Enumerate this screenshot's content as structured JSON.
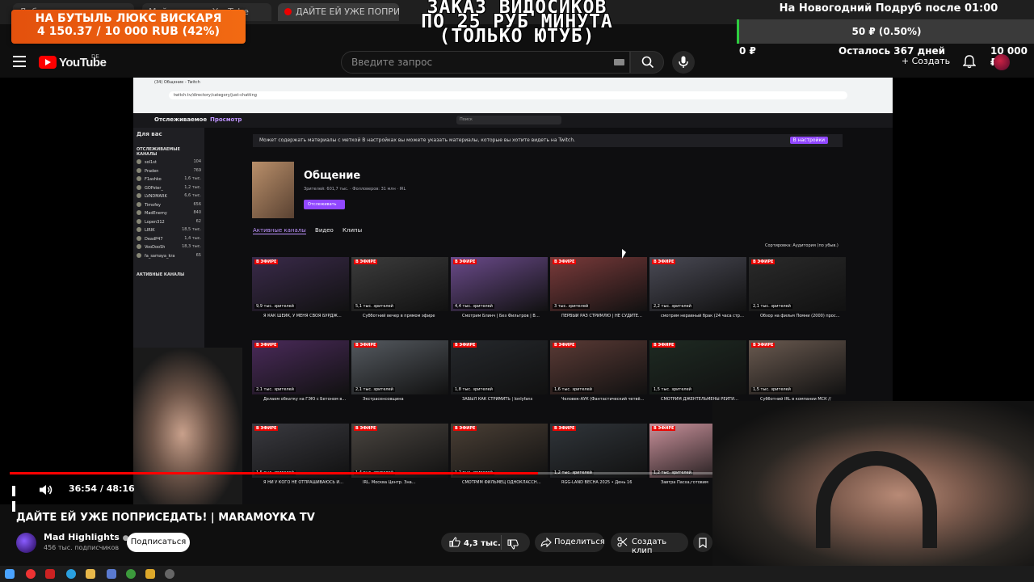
{
  "browser_tabs": [
    {
      "label": "Добро пожаловать в"
    },
    {
      "label": "Мой канал — YouTube"
    },
    {
      "label": "ДАЙТЕ ЕЙ УЖЕ ПОПРИСЕДАТЬ!"
    }
  ],
  "overlay": {
    "donation_title": "НА БУТЫЛЬ ЛЮКС ВИСКАРЯ",
    "donation_progress": "4 150.37 / 10 000 RUB (42%)",
    "donation_percent": 42,
    "promo_line1": "ЗАКАЗ ВИДОСИКОВ",
    "promo_line2": "ПО 25 РУБ МИНУТА",
    "promo_line3": "(ТОЛЬКО ЮТУБ)",
    "goal_title": "На Новогодний Подруб после 01:00",
    "goal_progress": "50 ₽ (0.50%)",
    "goal_min": "0 ₽",
    "goal_remaining": "Осталось 367 дней",
    "goal_max": "10 000 ₽"
  },
  "youtube": {
    "logo_text": "YouTube",
    "region": "DE",
    "search_placeholder": "Введите запрос",
    "create_label": "+ Создать"
  },
  "twitch": {
    "tab_title": "(34) Общение - Twitch",
    "url": "twitch.tv/directory/category/just-chatting",
    "nav_following": "Отслеживаемое",
    "nav_browse": "Просмотр",
    "search_placeholder": "Поиск",
    "banner_text": "Может содержать материалы с меткой В настройках вы можете указать материалы, которые вы хотите видеть на Twitch.",
    "banner_button": "В настройки",
    "category_title": "Общение",
    "category_stats": "Зрителей: 601,7 тыс. · Фолловеров: 31 млн · IRL",
    "follow_button": "Отслеживать",
    "tabs": [
      "Активные каналы",
      "Видео",
      "Клипы"
    ],
    "sort_label": "Сортировка: Аудитория (по убыв.)",
    "sidebar_header": "Для вас",
    "sidebar_followed": "ОТСЛЕЖИВАЕМЫЕ КАНАЛЫ",
    "sidebar_channels": [
      {
        "name": "sol1st",
        "viewers": "104"
      },
      {
        "name": "Praden",
        "viewers": "769"
      },
      {
        "name": "F1ashko",
        "viewers": "1,6 тыс."
      },
      {
        "name": "GOPster_",
        "viewers": "1,2 тыс."
      },
      {
        "name": "LVNDMARK",
        "viewers": "6,6 тыс."
      },
      {
        "name": "Timofey",
        "viewers": "656"
      },
      {
        "name": "MadEnemy",
        "viewers": "840"
      },
      {
        "name": "Lopen312",
        "viewers": "62"
      },
      {
        "name": "LIRIK",
        "viewers": "18,5 тыс."
      },
      {
        "name": "DeadP47",
        "viewers": "1,4 тыс."
      },
      {
        "name": "VooDooSh",
        "viewers": "18,3 тыс."
      },
      {
        "name": "fa_samaya_kra",
        "viewers": "65"
      }
    ],
    "sidebar_active": "АКТИВНЫЕ КАНАЛЫ",
    "streams": [
      {
        "title": "Я КАК ШЕЙК, У МЕНЯ СВОЯ БУРДЖ…",
        "viewers": "9,9 тыс. зрителей",
        "color": "#3a2a4a"
      },
      {
        "title": "Субботний вечер в прямом эфире",
        "viewers": "5,1 тыс. зрителей",
        "color": "#3c3c3c"
      },
      {
        "title": "Смотрим Блинч | Без Фильтров | В…",
        "viewers": "4,4 тыс. зрителей",
        "color": "#6a4a8a"
      },
      {
        "title": "ПЕРВЫЙ РАЗ СТРИМЛЮ | НЕ СУДИТЕ…",
        "viewers": "3 тыс. зрителей",
        "color": "#7a3a3a"
      },
      {
        "title": "смотрим неравный брак (24 часа стр…",
        "viewers": "2,2 тыс. зрителей",
        "color": "#4a4a55"
      },
      {
        "title": "Обзор на фильм Помни (2000) прос…",
        "viewers": "2,1 тыс. зрителей",
        "color": "#2a2a2a"
      },
      {
        "title": "Делаем обкатку на ГЭЮ с Бетоном в…",
        "viewers": "2,1 тыс. зрителей",
        "color": "#4a2a5a"
      },
      {
        "title": "Экстрасенсовщина",
        "viewers": "2,1 тыс. зрителей",
        "color": "#555a60"
      },
      {
        "title": "ЗАБЫЛ КАК СТРИМИТЬ | lonlyfans",
        "viewers": "1,8 тыс. зрителей",
        "color": "#25282c"
      },
      {
        "title": "Человек-АУК (Фантастический четвё…",
        "viewers": "1,6 тыс. зрителей",
        "color": "#5a3a35"
      },
      {
        "title": "СМОТРИМ ДЖЕНТЕЛЬМЕНЫ РЕЙТИ…",
        "viewers": "1,5 тыс. зрителей",
        "color": "#1e2a22"
      },
      {
        "title": "Субботний IRL в компании МСК //",
        "viewers": "1,5 тыс. зрителей",
        "color": "#6a5a50"
      },
      {
        "title": "Я НИ У КОГО НЕ ОТПРАШИВАЮСЬ И…",
        "viewers": "1,5 тыс. зрителей",
        "color": "#3a3a40"
      },
      {
        "title": "IRL. Москва Центр. Зна…",
        "viewers": "1,4 тыс. зрителей",
        "color": "#4a4540"
      },
      {
        "title": "СМОТРИМ ФИЛЬМЕЦ ОДНОКЛАССН…",
        "viewers": "1,2 тыс. зрителей",
        "color": "#4a3f35"
      },
      {
        "title": "RGG-LAND ВЕСНА 2025 • День 16",
        "viewers": "1,2 тыс. зрителей",
        "color": "#30353a"
      },
      {
        "title": "Завтра Пасха,готовим",
        "viewers": "1,2 тыс. зрителей",
        "color": "#c8909a"
      }
    ],
    "live_label": "В ЭФИРЕ"
  },
  "player": {
    "current_time": "36:54",
    "duration": "48:16",
    "time_display": "36:54 / 48:16",
    "progress_percent": 76.4
  },
  "video": {
    "title": "ДАЙТЕ ЕЙ УЖЕ ПОПРИСЕДАТЬ! | MARAMOYKA TV",
    "channel_name": "Mad Highlights",
    "subscribers": "456 тыс. подписчиков",
    "subscribe_label": "Подписаться",
    "likes": "4,3 тыс.",
    "share_label": "Поделиться",
    "clip_label": "Создать клип"
  },
  "colors": {
    "youtube_red": "#ff0000",
    "twitch_purple": "#9147ff",
    "donation_orange": "#f26a12",
    "goal_green": "#2ecc40"
  }
}
